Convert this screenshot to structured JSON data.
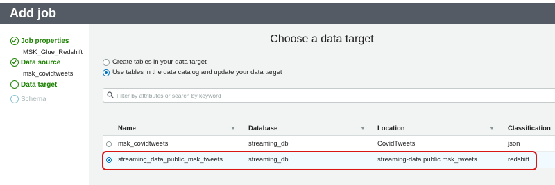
{
  "window": {
    "title": "Add job"
  },
  "sidebar": {
    "steps": [
      {
        "label": "Job properties",
        "sub": "MSK_Glue_Redshift",
        "state": "complete"
      },
      {
        "label": "Data source",
        "sub": "msk_covidtweets",
        "state": "complete"
      },
      {
        "label": "Data target",
        "sub": "",
        "state": "current"
      },
      {
        "label": "Schema",
        "sub": "",
        "state": "inactive"
      }
    ]
  },
  "main": {
    "heading": "Choose a data target",
    "options": [
      {
        "label": "Create tables in your data target",
        "checked": false
      },
      {
        "label": "Use tables in the data catalog and update your data target",
        "checked": true
      }
    ],
    "filter": {
      "placeholder": "Filter by attributes or search by keyword"
    },
    "table": {
      "columns": [
        "Name",
        "Database",
        "Location",
        "Classification"
      ],
      "rows": [
        {
          "name": "msk_covidtweets",
          "database": "streaming_db",
          "location": "CovidTweets",
          "classification": "json",
          "selected": false
        },
        {
          "name": "streaming_data_public_msk_tweets",
          "database": "streaming_db",
          "location": "streaming-data.public.msk_tweets",
          "classification": "redshift",
          "selected": true
        }
      ]
    }
  },
  "colors": {
    "header_bg": "#545b64",
    "complete_green": "#1d8102",
    "selected_blue": "#0073bb",
    "highlight_red": "#d91515"
  },
  "icons": {
    "step_complete": "check-circle-icon",
    "step_pending": "circle-icon",
    "search": "search-icon"
  }
}
